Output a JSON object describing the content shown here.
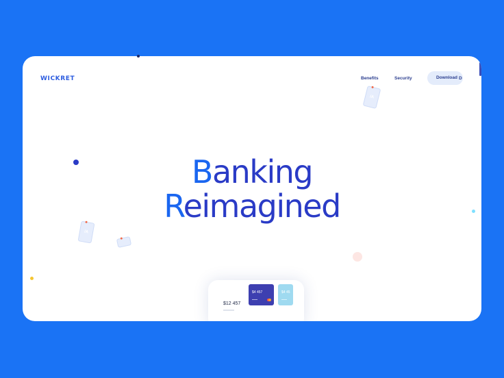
{
  "brand": {
    "name": "WICKRET"
  },
  "nav": {
    "benefits": "Benefits",
    "security": "Security",
    "download": "Download",
    "cut": "D"
  },
  "hero": {
    "line1_first": "B",
    "line1_rest": "anking",
    "line2_first": "R",
    "line2_rest": "eimagined"
  },
  "card_badges": {
    "symbol": "/A"
  },
  "phone": {
    "balance": "$12 457",
    "card1_amount": "$4 457",
    "card2_amount": "$4 45"
  },
  "colors": {
    "background": "#1a73f5",
    "accent": "#1a66f0",
    "headline": "#2a3bc6",
    "card_dark": "#3d3fb0",
    "card_light": "#9fdaf0"
  }
}
